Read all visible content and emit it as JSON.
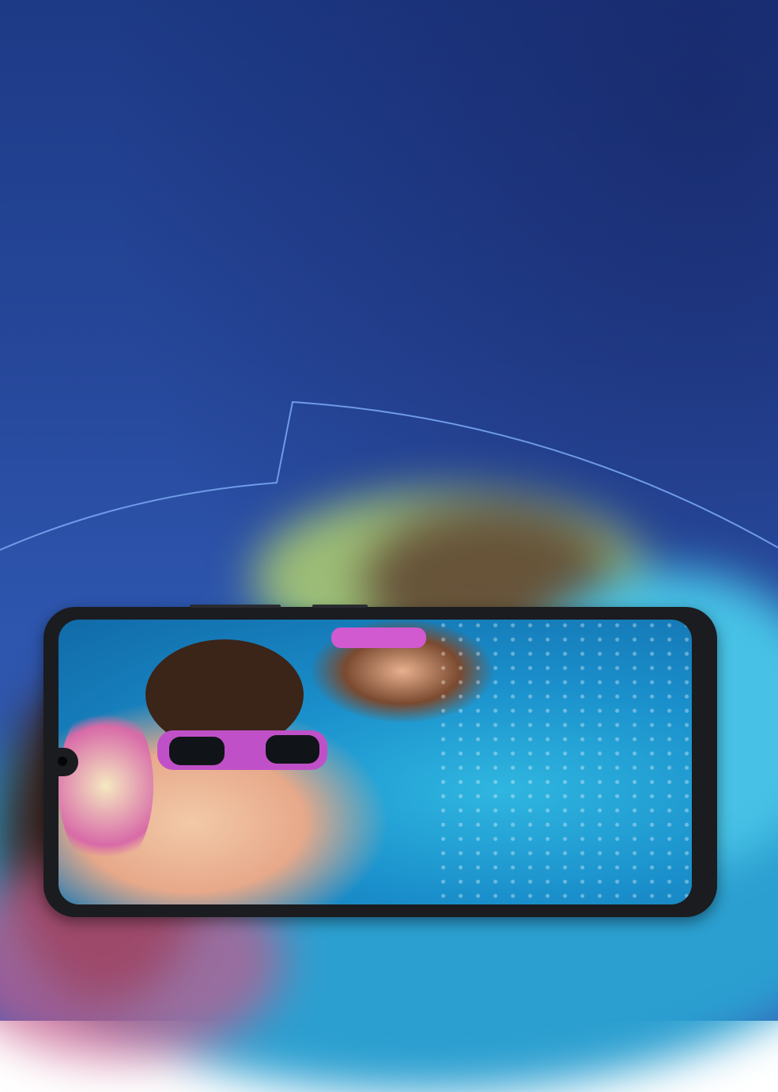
{
  "colors": {
    "background_top": "#1d3a86",
    "background_bottom": "#3561b8",
    "arc_line": "#6f9be8",
    "phone_frame": "#1b1c20",
    "water": "#1a8fcb"
  },
  "icons": {
    "camera": "punch-hole-camera"
  }
}
